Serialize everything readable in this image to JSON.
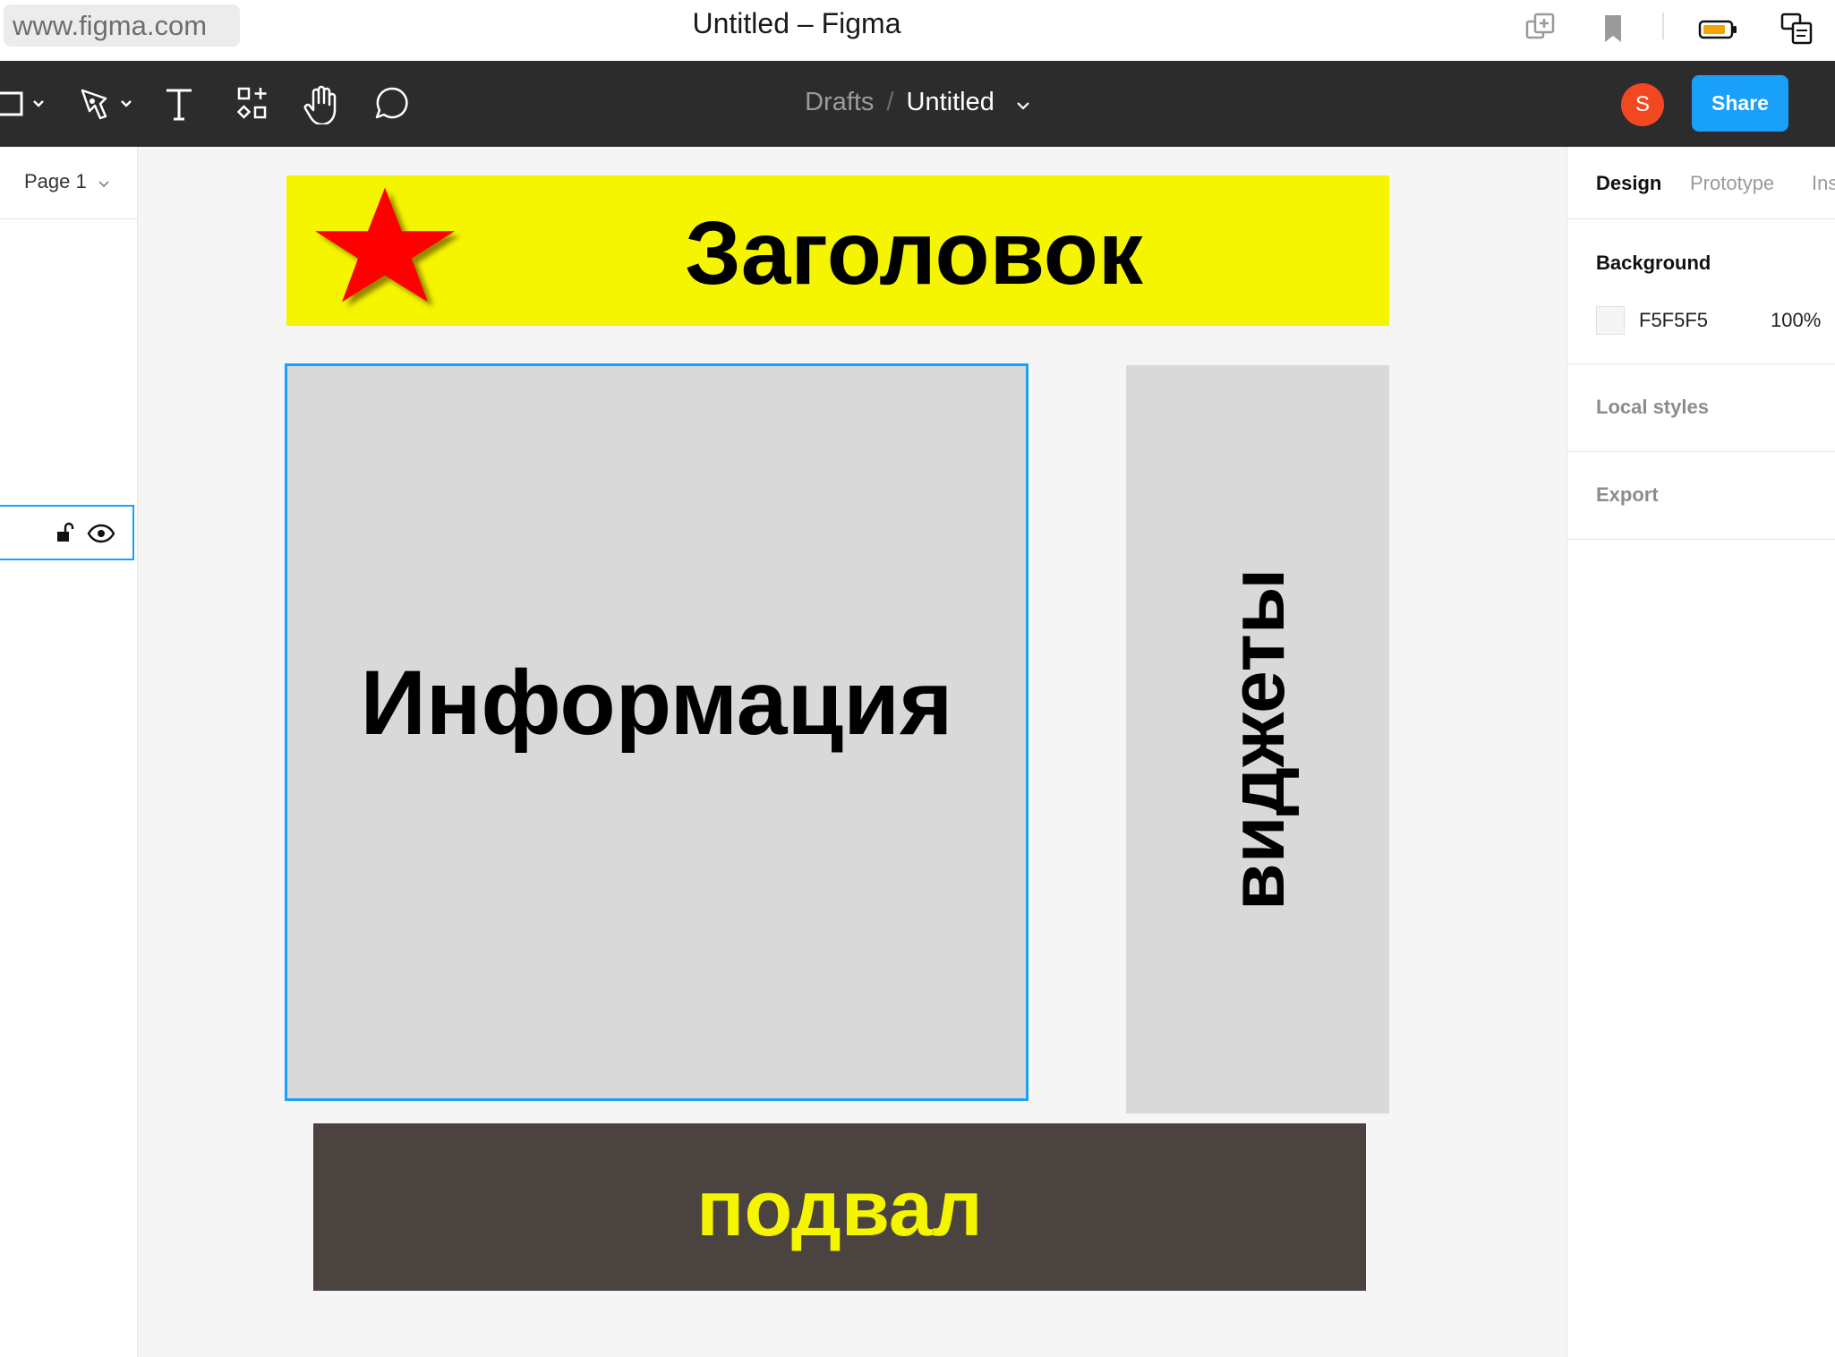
{
  "browser": {
    "url": "www.figma.com",
    "window_title": "Untitled – Figma"
  },
  "toolbar": {
    "breadcrumb_parent": "Drafts",
    "breadcrumb_sep": "/",
    "file_name": "Untitled",
    "avatar_initial": "S",
    "share_label": "Share"
  },
  "left_panel": {
    "page_selector": "Page 1"
  },
  "canvas": {
    "header_text": "Заголовок",
    "info_text": "Информация",
    "widgets_text": "виджеты",
    "footer_text": "подвал",
    "colors": {
      "header_bg": "#f5f500",
      "frame_gray": "#d9d9d9",
      "footer_bg": "#4a4340",
      "footer_text": "#f5f500",
      "star": "#ff0000",
      "selection": "#18a0fb"
    }
  },
  "right_panel": {
    "tabs": [
      "Design",
      "Prototype",
      "Inspect"
    ],
    "background_label": "Background",
    "background_hex": "F5F5F5",
    "background_opacity": "100%",
    "local_styles_label": "Local styles",
    "export_label": "Export"
  }
}
